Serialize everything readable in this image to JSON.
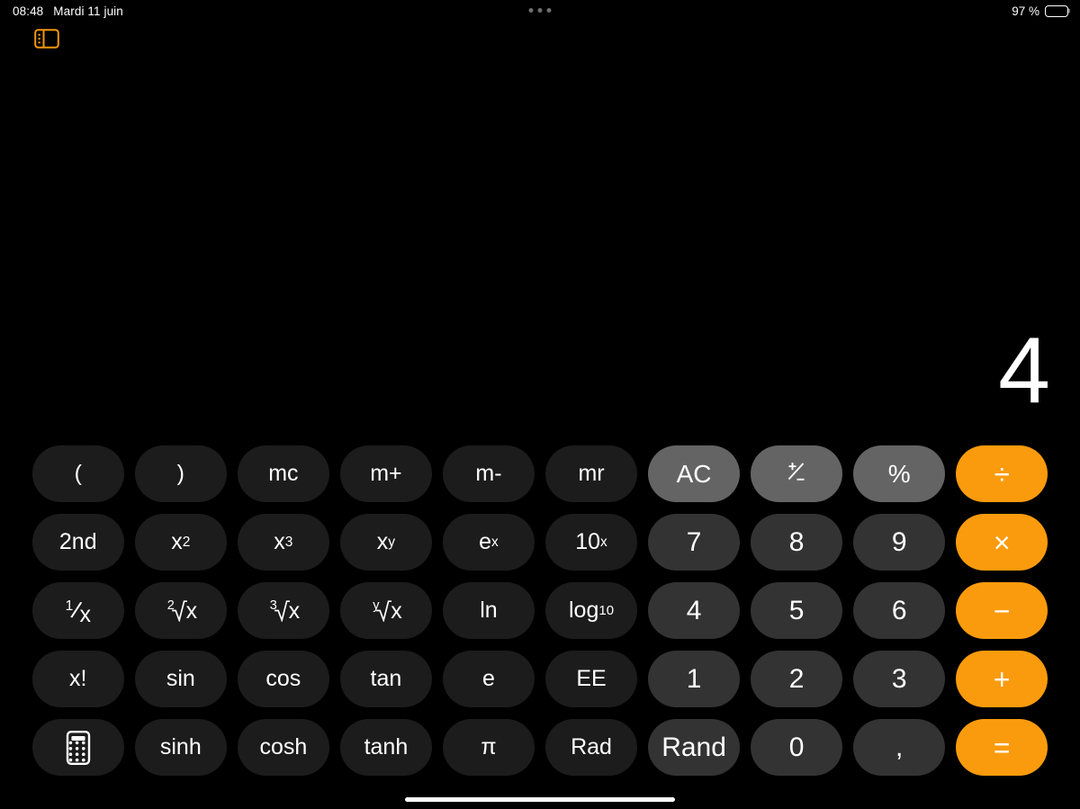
{
  "status_bar": {
    "time": "08:48",
    "date": "Mardi 11 juin",
    "battery_percent": "97 %",
    "multitask_icon": "three-dots-icon",
    "battery_icon": "battery-full-icon"
  },
  "sidebar": {
    "toggle_icon": "sidebar-toggle-icon",
    "toggle_color": "#f2960b"
  },
  "display": {
    "value": "4"
  },
  "theme": {
    "background": "#000000",
    "function_key": "#1c1c1c",
    "digit_key": "#333333",
    "utility_key": "#646464",
    "operator_key": "#f99b0c",
    "text": "#ffffff"
  },
  "keypad": {
    "rows": [
      [
        {
          "label": "(",
          "name": "key-open-paren",
          "type": "func"
        },
        {
          "label": ")",
          "name": "key-close-paren",
          "type": "func"
        },
        {
          "label": "mc",
          "name": "key-memory-clear",
          "type": "func"
        },
        {
          "label": "m+",
          "name": "key-memory-add",
          "type": "func"
        },
        {
          "label": "m-",
          "name": "key-memory-subtract",
          "type": "func"
        },
        {
          "label": "mr",
          "name": "key-memory-recall",
          "type": "func"
        },
        {
          "label": "AC",
          "name": "key-all-clear",
          "type": "utility"
        },
        {
          "label": "+/-",
          "name": "key-sign-toggle",
          "type": "utility"
        },
        {
          "label": "%",
          "name": "key-percent",
          "type": "utility"
        },
        {
          "label": "÷",
          "name": "key-divide",
          "type": "operator"
        }
      ],
      [
        {
          "label": "2nd",
          "name": "key-second-function",
          "type": "func"
        },
        {
          "label": "x²",
          "name": "key-square",
          "type": "func"
        },
        {
          "label": "x³",
          "name": "key-cube",
          "type": "func"
        },
        {
          "label": "xʸ",
          "name": "key-power-y",
          "type": "func"
        },
        {
          "label": "eˣ",
          "name": "key-exp-e",
          "type": "func"
        },
        {
          "label": "10ˣ",
          "name": "key-exp-ten",
          "type": "func"
        },
        {
          "label": "7",
          "name": "key-7",
          "type": "digit"
        },
        {
          "label": "8",
          "name": "key-8",
          "type": "digit"
        },
        {
          "label": "9",
          "name": "key-9",
          "type": "digit"
        },
        {
          "label": "×",
          "name": "key-multiply",
          "type": "operator"
        }
      ],
      [
        {
          "label": "1/x",
          "name": "key-reciprocal",
          "type": "func"
        },
        {
          "label": "²√x",
          "name": "key-square-root",
          "type": "func"
        },
        {
          "label": "³√x",
          "name": "key-cube-root",
          "type": "func"
        },
        {
          "label": "ʸ√x",
          "name": "key-nth-root",
          "type": "func"
        },
        {
          "label": "ln",
          "name": "key-natural-log",
          "type": "func"
        },
        {
          "label": "log₁₀",
          "name": "key-log-base-10",
          "type": "func"
        },
        {
          "label": "4",
          "name": "key-4",
          "type": "digit"
        },
        {
          "label": "5",
          "name": "key-5",
          "type": "digit"
        },
        {
          "label": "6",
          "name": "key-6",
          "type": "digit"
        },
        {
          "label": "−",
          "name": "key-subtract",
          "type": "operator"
        }
      ],
      [
        {
          "label": "x!",
          "name": "key-factorial",
          "type": "func"
        },
        {
          "label": "sin",
          "name": "key-sin",
          "type": "func"
        },
        {
          "label": "cos",
          "name": "key-cos",
          "type": "func"
        },
        {
          "label": "tan",
          "name": "key-tan",
          "type": "func"
        },
        {
          "label": "e",
          "name": "key-euler",
          "type": "func"
        },
        {
          "label": "EE",
          "name": "key-ee",
          "type": "func"
        },
        {
          "label": "1",
          "name": "key-1",
          "type": "digit"
        },
        {
          "label": "2",
          "name": "key-2",
          "type": "digit"
        },
        {
          "label": "3",
          "name": "key-3",
          "type": "digit"
        },
        {
          "label": "+",
          "name": "key-add",
          "type": "operator"
        }
      ],
      [
        {
          "label": "",
          "name": "key-calculator-mode",
          "type": "func",
          "icon": "calculator-icon"
        },
        {
          "label": "sinh",
          "name": "key-sinh",
          "type": "func"
        },
        {
          "label": "cosh",
          "name": "key-cosh",
          "type": "func"
        },
        {
          "label": "tanh",
          "name": "key-tanh",
          "type": "func"
        },
        {
          "label": "π",
          "name": "key-pi",
          "type": "func"
        },
        {
          "label": "Rad",
          "name": "key-rad",
          "type": "func"
        },
        {
          "label": "Rand",
          "name": "key-random",
          "type": "digit"
        },
        {
          "label": "0",
          "name": "key-0",
          "type": "digit"
        },
        {
          "label": ",",
          "name": "key-decimal-separator",
          "type": "digit"
        },
        {
          "label": "=",
          "name": "key-equals",
          "type": "operator"
        }
      ]
    ]
  },
  "home_indicator": {
    "name": "home-indicator"
  }
}
